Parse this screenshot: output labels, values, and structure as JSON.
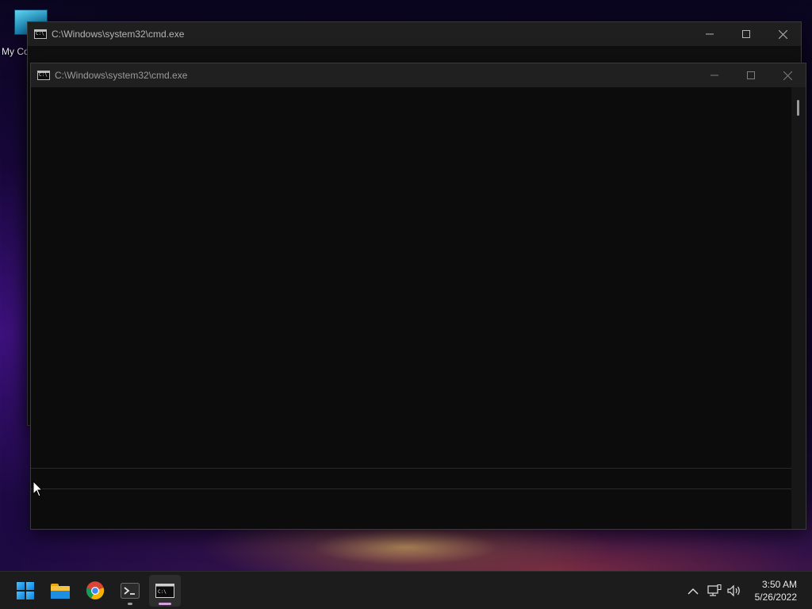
{
  "desktop": {
    "icons": [
      {
        "label": "My Co",
        "icon": "computer-icon"
      }
    ]
  },
  "windows": [
    {
      "title": "C:\\Windows\\system32\\cmd.exe",
      "state": "background",
      "controls": {
        "minimize": "—",
        "maximize": "☐",
        "close": "✕"
      }
    },
    {
      "title": "C:\\Windows\\system32\\cmd.exe",
      "state": "foreground-inactive",
      "controls": {
        "minimize": "—",
        "maximize": "☐",
        "close": "✕"
      },
      "console_text": ""
    }
  ],
  "taskbar": {
    "apps": [
      {
        "name": "Start",
        "icon": "windows-start-icon"
      },
      {
        "name": "File Explorer",
        "icon": "folder-icon"
      },
      {
        "name": "Google Chrome",
        "icon": "chrome-icon"
      },
      {
        "name": "Windows Terminal",
        "icon": "terminal-icon",
        "running": true
      },
      {
        "name": "Command Prompt",
        "icon": "cmd-icon",
        "running": true,
        "active": true
      }
    ],
    "tray": {
      "overflow_icon": "chevron-up-icon",
      "network_icon": "network-icon",
      "volume_icon": "volume-icon"
    },
    "clock": {
      "time": "3:50 AM",
      "date": "5/26/2022"
    }
  },
  "colors": {
    "console_bg": "#0c0c0c",
    "titlebar_bg": "#202020",
    "taskbar_bg": "#1c1c1c",
    "active_indicator": "#d6a0e0"
  }
}
